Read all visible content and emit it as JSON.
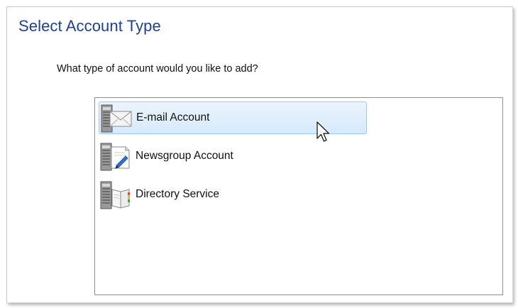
{
  "dialog": {
    "heading": "Select Account Type",
    "prompt": "What type of account would you like to add?"
  },
  "account_types": {
    "selected_index": 0,
    "items": [
      {
        "label": "E-mail Account",
        "icon": "email-server-icon"
      },
      {
        "label": "Newsgroup Account",
        "icon": "newsgroup-server-icon"
      },
      {
        "label": "Directory Service",
        "icon": "directory-server-icon"
      }
    ]
  },
  "colors": {
    "heading": "#1e3f9a",
    "selection_border": "#9dcaf0",
    "selection_fill": "#d7eafb"
  }
}
